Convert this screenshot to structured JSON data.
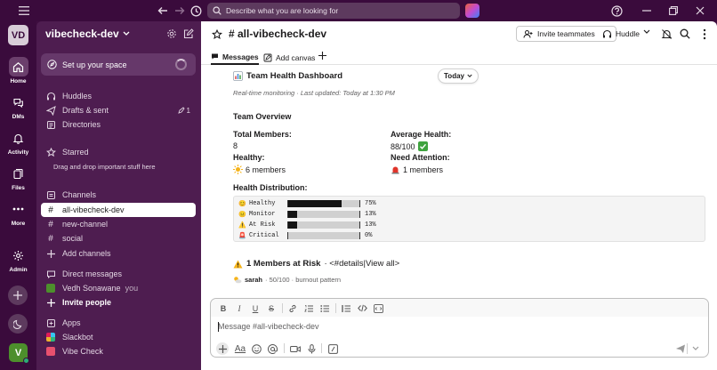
{
  "topbar": {
    "search_placeholder": "Describe what you are looking for"
  },
  "rail": {
    "workspace_initials": "VD",
    "items": [
      {
        "label": "Home",
        "icon": "home-icon"
      },
      {
        "label": "DMs",
        "icon": "dms-icon"
      },
      {
        "label": "Activity",
        "icon": "bell-icon"
      },
      {
        "label": "Files",
        "icon": "files-icon"
      },
      {
        "label": "More",
        "icon": "more-icon"
      },
      {
        "label": "Admin",
        "icon": "gear-icon"
      }
    ],
    "user_initial": "V"
  },
  "sidebar": {
    "workspace_name": "vibecheck-dev",
    "setup_label": "Set up your space",
    "huddles": "Huddles",
    "drafts": "Drafts & sent",
    "drafts_count": "1",
    "directories": "Directories",
    "starred": "Starred",
    "starred_hint": "Drag and drop important stuff here",
    "channels_header": "Channels",
    "channels": [
      "all-vibecheck-dev",
      "new-channel",
      "social"
    ],
    "add_channels": "Add channels",
    "dm_header": "Direct messages",
    "dm_user": "Vedh Sonawane",
    "dm_you": "you",
    "invite_people": "Invite people",
    "apps_header": "Apps",
    "apps": [
      "Slackbot",
      "Vibe Check"
    ]
  },
  "header": {
    "channel_name": "# all-vibecheck-dev",
    "invite_label": "Invite teammates",
    "huddle_label": "Huddle"
  },
  "tabs": {
    "messages": "Messages",
    "add_canvas": "Add canvas"
  },
  "message": {
    "title": "Team Health Dashboard",
    "today_label": "Today",
    "subtitle": "Real-time monitoring · Last updated: Today at 1:30 PM",
    "overview_title": "Team Overview",
    "total_members_label": "Total Members:",
    "total_members_value": "8",
    "avg_health_label": "Average Health:",
    "avg_health_value": "88/100",
    "healthy_label": "Healthy:",
    "healthy_value": "6 members",
    "need_attention_label": "Need Attention:",
    "need_attention_value": "1 members",
    "distribution_title": "Health Distribution:",
    "distribution": [
      {
        "emoji": "😊",
        "name": "Healthy",
        "pct": "75%",
        "fraction": 0.75
      },
      {
        "emoji": "😐",
        "name": "Monitor",
        "pct": "13%",
        "fraction": 0.13
      },
      {
        "emoji": "⚠️",
        "name": "At Risk",
        "pct": "13%",
        "fraction": 0.13
      },
      {
        "emoji": "🚨",
        "name": "Critical",
        "pct": "0%",
        "fraction": 0.0
      }
    ],
    "risk_title": "1 Members at Risk",
    "risk_link": "· <#details|View all>",
    "risk_user": "sarah",
    "risk_detail": "· 50/100 · burnout pattern"
  },
  "composer": {
    "placeholder": "Message #all-vibecheck-dev"
  },
  "colors": {
    "rail_bg": "#3a0b3c",
    "sidebar_bg": "#4e1d50",
    "accent_green": "#2bac76"
  }
}
